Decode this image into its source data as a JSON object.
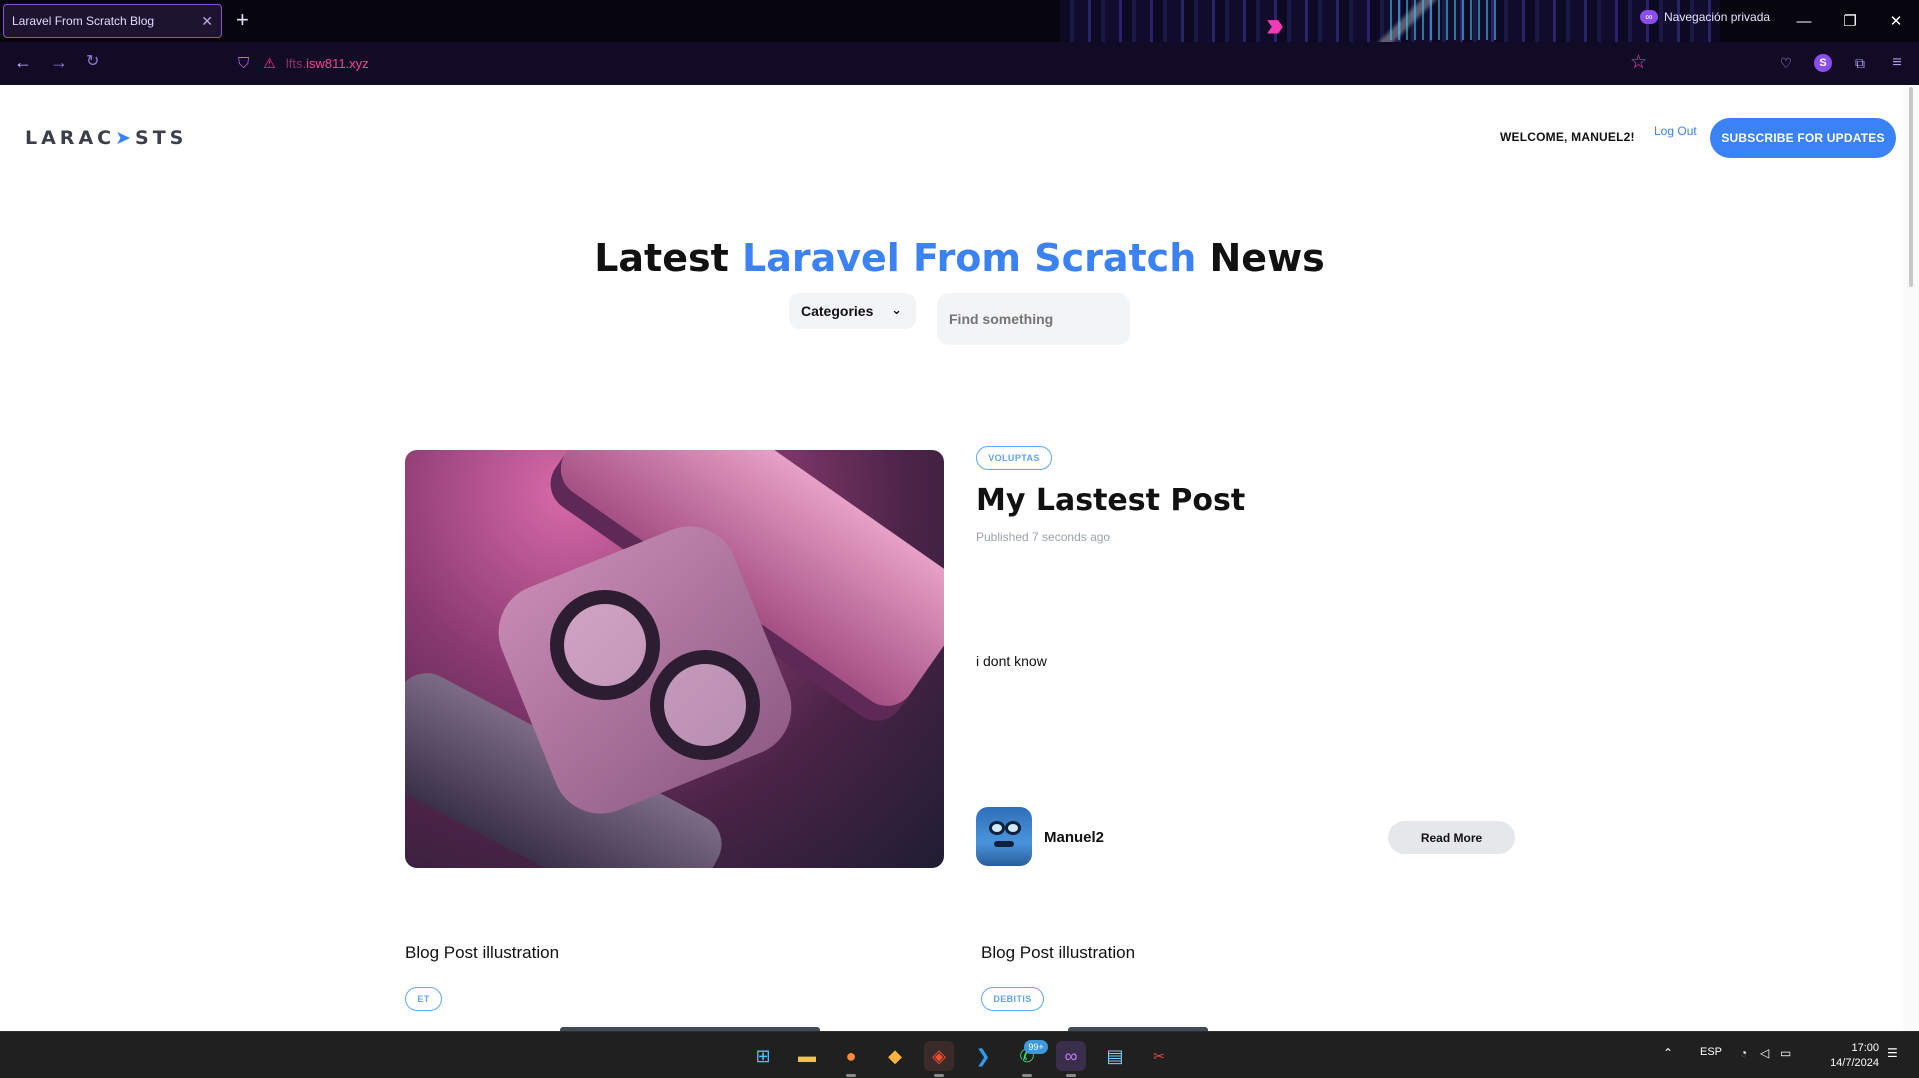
{
  "browser": {
    "tab_title": "Laravel From Scratch Blog",
    "tab_close": "✕",
    "new_tab": "+",
    "private_label": "Navegación privada",
    "url_prefix": "lfts.",
    "url_domain": "isw811.xyz",
    "window_controls": [
      "—",
      "❐",
      "✕"
    ]
  },
  "header": {
    "logo_text_a": "LARAC",
    "logo_text_b": "STS",
    "welcome": "WELCOME, MANUEL2!",
    "logout": "Log Out",
    "subscribe": "SUBSCRIBE FOR UPDATES"
  },
  "hero": {
    "title_start": "Latest ",
    "title_highlight": "Laravel From Scratch",
    "title_end": " News",
    "categories_label": "Categories",
    "search_placeholder": "Find something"
  },
  "featured_post": {
    "category": "VOLUPTAS",
    "title": "My Lastest Post",
    "published": "Published 7 seconds ago",
    "excerpt": "i dont know",
    "author": "Manuel2",
    "read_more": "Read More"
  },
  "posts": [
    {
      "title": "Blog Post illustration",
      "category": "ET"
    },
    {
      "title": "Blog Post illustration",
      "category": "DEBITIS"
    }
  ],
  "taskbar": {
    "badge": "99+",
    "language": "ESP",
    "time": "17:00",
    "date": "14/7/2024"
  },
  "colors": {
    "accent": "#3b82f6",
    "browser_bg": "#07050d",
    "url_domain": "#ff3d97"
  }
}
